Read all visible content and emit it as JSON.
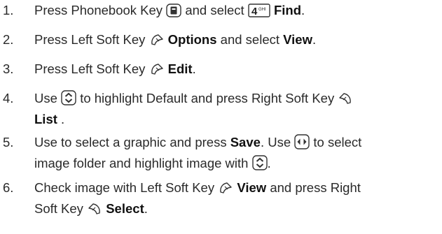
{
  "steps": [
    {
      "number": "1.",
      "t1": "Press Phonebook Key",
      "t2": "and select",
      "b1": "Find",
      "t3": ".",
      "icons": [
        "phonebook-key-icon",
        "4ghi-key-icon"
      ]
    },
    {
      "number": "2.",
      "t1": "Press Left Soft Key",
      "b1": "Options",
      "t2": "and select",
      "b2": "View",
      "t3": ".",
      "icons": [
        "left-soft-key-icon"
      ]
    },
    {
      "number": "3.",
      "t1": "Press Left Soft Key",
      "b1": "Edit",
      "t2": ".",
      "icons": [
        "left-soft-key-icon"
      ]
    },
    {
      "number": "4.",
      "t1": "Use",
      "t2": "to highlight Default and press Right Soft Key",
      "b1": "List",
      "t3": ".",
      "icons": [
        "up-down-nav-key-icon",
        "right-soft-key-icon"
      ]
    },
    {
      "number": "5.",
      "t1": "Use to select a graphic and press",
      "b1": "Save",
      "t2": ". Use",
      "t3": "to select",
      "t4": "image folder and highlight image with",
      "t5": ".",
      "icons": [
        "left-right-nav-key-icon",
        "up-down-nav-key-icon"
      ]
    },
    {
      "number": "6.",
      "t1": "Check image with Left Soft Key",
      "b1": "View",
      "t2": "and press Right",
      "t3": "Soft Key",
      "b2": "Select",
      "t4": ".",
      "icons": [
        "left-soft-key-icon",
        "right-soft-key-icon"
      ]
    }
  ]
}
